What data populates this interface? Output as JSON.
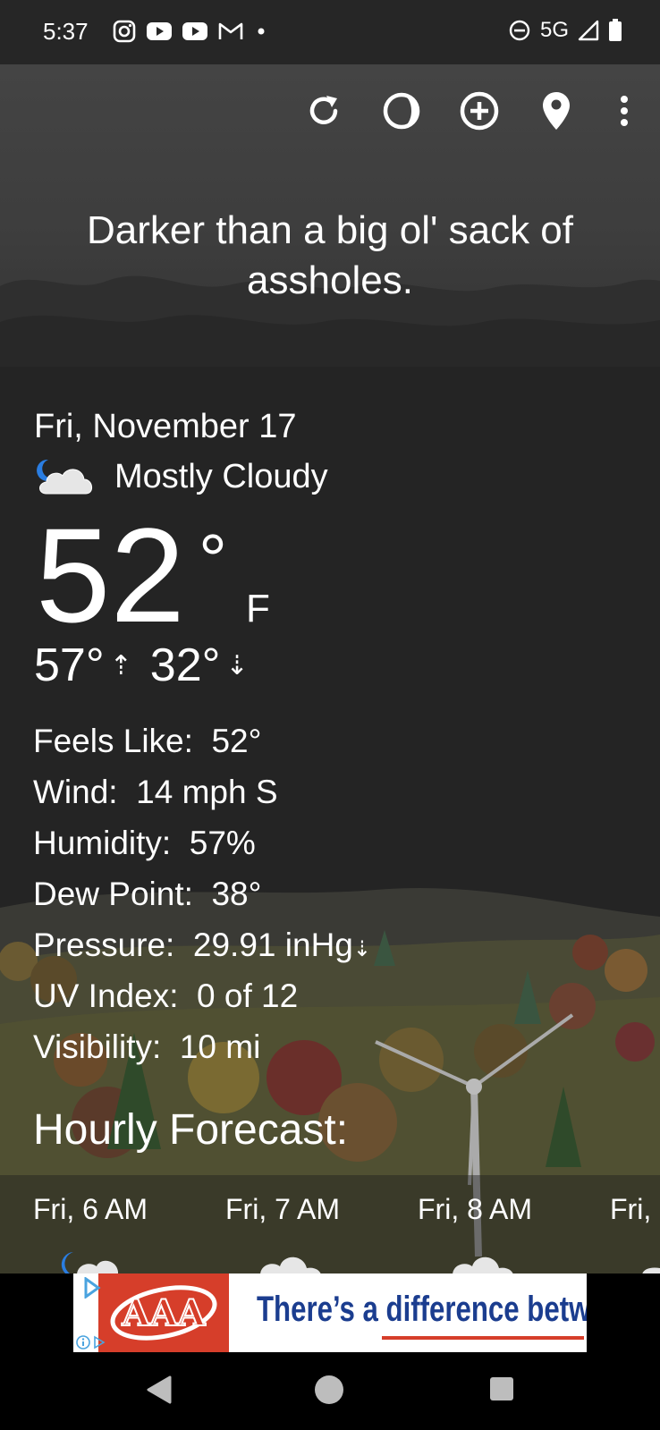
{
  "status_bar": {
    "time": "5:37",
    "network": "5G",
    "left_icons": [
      "instagram-icon",
      "youtube-icon",
      "youtube-icon",
      "gmail-icon",
      "dot-icon"
    ],
    "right_icons": [
      "do-not-disturb-icon",
      "signal-icon",
      "battery-icon"
    ]
  },
  "toolbar": {
    "icons": [
      "refresh-icon",
      "theme-icon",
      "add-location-icon",
      "location-pin-icon",
      "more-vert-icon"
    ]
  },
  "quote": "Darker than a big ol' sack of assholes.",
  "current": {
    "date": "Fri, November 17",
    "condition": "Mostly Cloudy",
    "condition_icon": "partly-cloudy-night-icon",
    "temp": "52",
    "degree": "°",
    "unit": "F",
    "high": "57°",
    "low": "32°"
  },
  "details": [
    {
      "label": "Feels Like:",
      "value": "52°"
    },
    {
      "label": "Wind:",
      "value": "14 mph S"
    },
    {
      "label": "Humidity:",
      "value": "57%"
    },
    {
      "label": "Dew Point:",
      "value": "38°"
    },
    {
      "label": "Pressure:",
      "value": "29.91 inHg",
      "trend": "falling"
    },
    {
      "label": "UV Index:",
      "value": "0 of 12"
    },
    {
      "label": "Visibility:",
      "value": "10 mi"
    }
  ],
  "hourly": {
    "title": "Hourly Forecast:",
    "hours": [
      {
        "label": "Fri, 6 AM",
        "icon": "partly-cloudy-night-icon"
      },
      {
        "label": "Fri, 7 AM",
        "icon": "cloud-icon"
      },
      {
        "label": "Fri, 8 AM",
        "icon": "cloud-icon"
      },
      {
        "label": "Fri,",
        "icon": "cloud-icon"
      }
    ]
  },
  "ad": {
    "brand": "AAA",
    "text": "There’s a difference betw"
  },
  "colors": {
    "background": "#242424",
    "sky": "#3d3d3d",
    "ad_red": "#d63e2a",
    "ad_blue": "#1b3d8f",
    "moon_blue": "#2a7de1"
  }
}
